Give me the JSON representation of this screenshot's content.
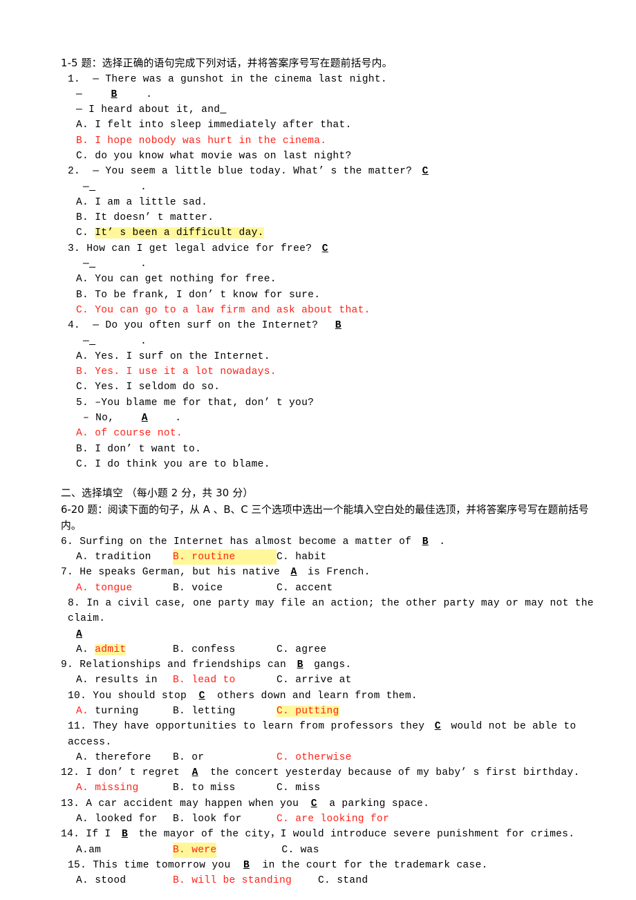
{
  "document": {
    "part_one": {
      "instruction": "1-5 题：选择正确的语句完成下列对话，并将答案序号写在题前括号内。",
      "questions": [
        {
          "number": "1.",
          "stem": "— There was a gunshot in the cinema last night.",
          "answer_line_prefix": "—",
          "answer_letter": "B",
          "answer_line_suffix": ".",
          "second_stem": "— I heard about it, and",
          "options": [
            {
              "label": "A.",
              "text": "I felt into sleep immediately after that.",
              "style": "plain"
            },
            {
              "label": "B.",
              "text": "I hope nobody was hurt in the cinema.",
              "style": "red"
            },
            {
              "label": "C.",
              "text": "do you know what movie was on last night?",
              "style": "plain"
            }
          ]
        },
        {
          "number": "2.",
          "stem": "— You seem a little blue today. What’ s the matter?",
          "inline_answer": "C",
          "answer_line_prefix": "—",
          "answer_line_suffix": ".",
          "options": [
            {
              "label": "A.",
              "text": "I am a little sad.",
              "style": "plain"
            },
            {
              "label": "B.",
              "text": "It doesn’ t matter.",
              "style": "plain"
            },
            {
              "label": "C.",
              "text": "It’ s been a difficult day.",
              "style": "highlight"
            }
          ]
        },
        {
          "number": "3.",
          "stem": "How can I get legal advice for free?",
          "inline_answer": "C",
          "answer_line_prefix": "—",
          "answer_line_suffix": ".",
          "options": [
            {
              "label": "A.",
              "text": "You can get nothing for free.",
              "style": "plain"
            },
            {
              "label": "B.",
              "text": "To be frank, I don’ t know for sure.",
              "style": "plain"
            },
            {
              "label": "C.",
              "text": "You can go to a law firm and ask about that.",
              "style": "red"
            }
          ]
        },
        {
          "number": "4.",
          "stem": "— Do you often surf on the Internet?",
          "inline_answer": "B",
          "answer_line_prefix": "—",
          "answer_line_suffix": ".",
          "options": [
            {
              "label": "A.",
              "text": "Yes. I surf on the Internet.",
              "style": "plain"
            },
            {
              "label": "B.",
              "text": "Yes. I use it a lot nowadays.",
              "style": "red"
            },
            {
              "label": "C.",
              "text": "Yes. I seldom do so.",
              "style": "plain"
            }
          ]
        },
        {
          "number": "5.",
          "stem": "–You blame me for that, don’ t you?",
          "answer_line_prefix": "– No,",
          "answer_letter": "A",
          "answer_line_suffix": ".",
          "options": [
            {
              "label": "A.",
              "text": "of course not.",
              "style": "red"
            },
            {
              "label": "B.",
              "text": "I don’ t want to.",
              "style": "plain"
            },
            {
              "label": "C.",
              "text": "I do think you are to blame.",
              "style": "plain"
            }
          ]
        }
      ]
    },
    "part_two": {
      "heading": "二、选择填空 （每小题 2 分，共 30 分）",
      "instruction": "6-20 题：阅读下面的句子，从 A 、B、C 三个选项中选出一个能填入空白处的最佳选顶，并将答案序号写在题前括号内。",
      "questions": [
        {
          "number": "6.",
          "stem_before": "Surfing on the Internet has almost become a matter of",
          "answer": "B",
          "stem_after": ".",
          "options": [
            {
              "label": "A.",
              "text": "tradition",
              "style": "plain"
            },
            {
              "label": "B.",
              "text": "routine",
              "style": "highlight-red"
            },
            {
              "label": "C.",
              "text": "habit",
              "style": "plain"
            }
          ]
        },
        {
          "number": "7.",
          "stem_before": "He speaks German, but his native",
          "answer": "A",
          "stem_after": "is French.",
          "options": [
            {
              "label": "A.",
              "text": "tongue",
              "style": "red"
            },
            {
              "label": "B.",
              "text": "voice",
              "style": "plain"
            },
            {
              "label": "C.",
              "text": "accent",
              "style": "plain"
            }
          ]
        },
        {
          "number": "8.",
          "stem_before": "In a civil case, one party may file an action; the other party may or may not the claim.",
          "answer": "A",
          "stem_after": "",
          "options": [
            {
              "label": "A.",
              "text": "admit",
              "style": "highlight-red"
            },
            {
              "label": "B.",
              "text": "confess",
              "style": "plain"
            },
            {
              "label": "C.",
              "text": "agree",
              "style": "plain"
            }
          ]
        },
        {
          "number": "9.",
          "stem_before": "Relationships and friendships can",
          "answer": "B",
          "stem_after": "gangs.",
          "options": [
            {
              "label": "A.",
              "text": "results in",
              "style": "plain"
            },
            {
              "label": "B.",
              "text": "lead to",
              "style": "red"
            },
            {
              "label": "C.",
              "text": "arrive at",
              "style": "plain"
            }
          ]
        },
        {
          "number": "10.",
          "stem_before": "You should stop",
          "answer": "C",
          "stem_after": "others down and learn from them.",
          "options": [
            {
              "label": "A.",
              "text": "turning",
              "style": "red-label-only"
            },
            {
              "label": "B.",
              "text": "letting",
              "style": "plain"
            },
            {
              "label": "C.",
              "text": "putting",
              "style": "highlight-red"
            }
          ]
        },
        {
          "number": "11.",
          "stem_before": "They have opportunities to learn from professors they",
          "answer": "C",
          "stem_after": "would not be able to access.",
          "options": [
            {
              "label": "A.",
              "text": "therefore",
              "style": "plain"
            },
            {
              "label": "B.",
              "text": "or",
              "style": "plain"
            },
            {
              "label": "C.",
              "text": "otherwise",
              "style": "red"
            }
          ]
        },
        {
          "number": "12.",
          "stem_before": "I don’ t regret",
          "answer": "A",
          "stem_after": "the concert yesterday because of my baby’ s first birthday.",
          "options": [
            {
              "label": "A.",
              "text": "missing",
              "style": "red"
            },
            {
              "label": "B.",
              "text": "to miss",
              "style": "plain"
            },
            {
              "label": "C.",
              "text": "miss",
              "style": "plain"
            }
          ]
        },
        {
          "number": "13.",
          "stem_before": "A car accident may happen when you",
          "answer": "C",
          "stem_after": "a parking space.",
          "options": [
            {
              "label": "A.",
              "text": "looked for",
              "style": "plain"
            },
            {
              "label": "B.",
              "text": "look for",
              "style": "plain"
            },
            {
              "label": "C.",
              "text": "are looking for",
              "style": "red"
            }
          ]
        },
        {
          "number": "14.",
          "stem_before": "If I",
          "answer": "B",
          "stem_after": "the mayor of the city，I would introduce severe punishment for crimes.",
          "options": [
            {
              "label": "A.",
              "text": "am",
              "style": "plain",
              "tight": true
            },
            {
              "label": "B.",
              "text": "were",
              "style": "highlight-red"
            },
            {
              "label": "C.",
              "text": "was",
              "style": "plain"
            }
          ]
        },
        {
          "number": "15.",
          "stem_before": "This time tomorrow you",
          "answer": "B",
          "stem_after": "in the court for the trademark case.",
          "options": [
            {
              "label": "A.",
              "text": "stood",
              "style": "plain"
            },
            {
              "label": "B.",
              "text": "will be standing",
              "style": "red"
            },
            {
              "label": "C.",
              "text": "stand",
              "style": "plain"
            }
          ]
        }
      ]
    }
  },
  "colors": {
    "answer_red": "#ff2116",
    "highlight_yellow": "#fff79a",
    "text_black": "#000000"
  }
}
